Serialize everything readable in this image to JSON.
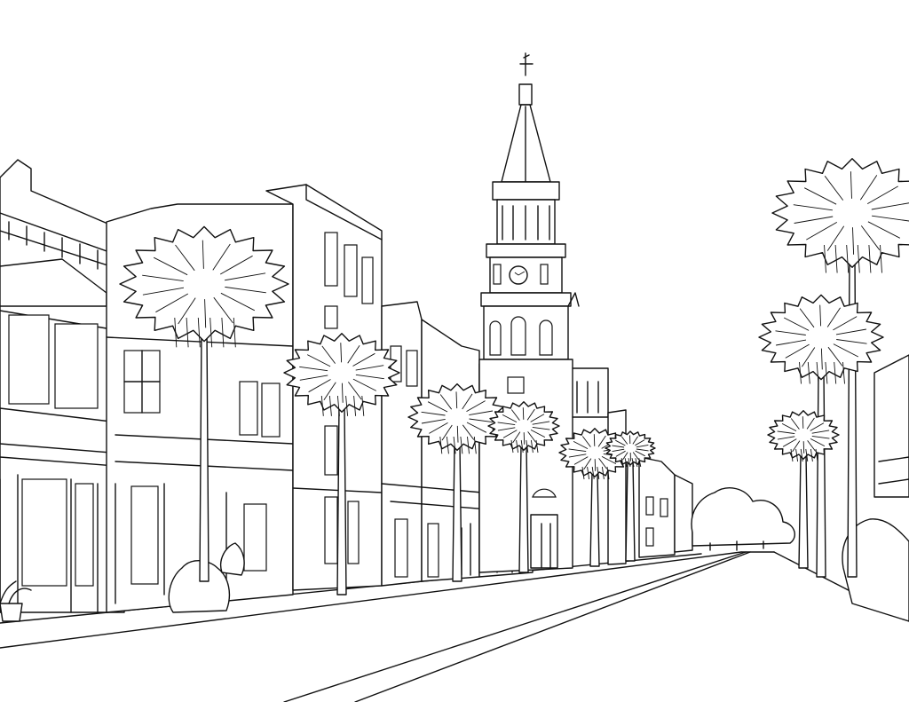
{
  "scene": {
    "kind": "line-art coloring page",
    "palette": {
      "ink": "#111111",
      "paper": "#ffffff"
    },
    "clock": {
      "hour": 10,
      "minute": 10
    },
    "palms": [
      {
        "id": "palm-1"
      },
      {
        "id": "palm-2"
      },
      {
        "id": "palm-3"
      },
      {
        "id": "palm-4"
      },
      {
        "id": "palm-5"
      },
      {
        "id": "palm-6"
      },
      {
        "id": "palm-7"
      },
      {
        "id": "palm-8"
      },
      {
        "id": "palm-9"
      }
    ]
  }
}
